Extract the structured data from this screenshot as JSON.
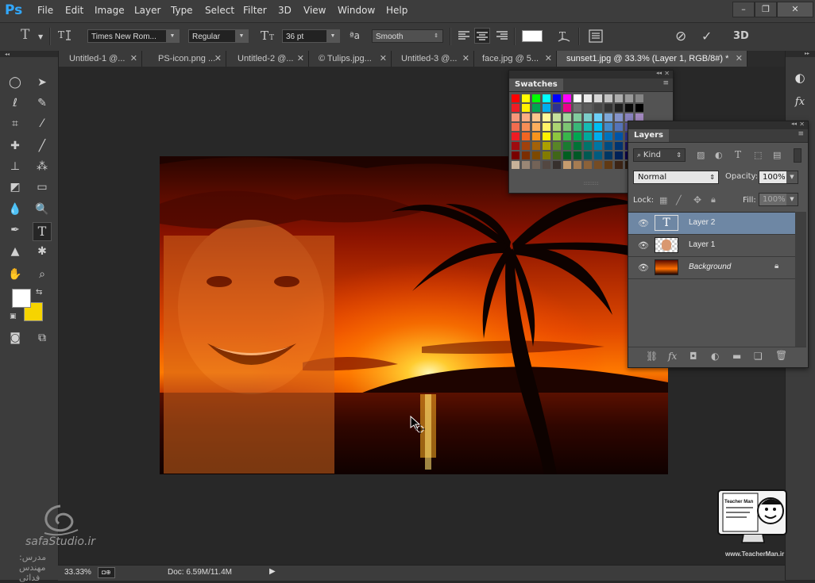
{
  "app": {
    "logo": "Ps"
  },
  "menu": [
    "File",
    "Edit",
    "Image",
    "Layer",
    "Type",
    "Select",
    "Filter",
    "3D",
    "View",
    "Window",
    "Help"
  ],
  "window_controls": [
    "–",
    "❐",
    "✕"
  ],
  "options": {
    "tool_glyph": "T",
    "font_family": "Times New Rom...",
    "font_style": "Regular",
    "font_size": "36 pt",
    "aa_label": "ªa",
    "antialias": "Smooth",
    "cancel_glyph": "⊘",
    "commit_glyph": "✓",
    "three_d": "3D",
    "text_color": "#ffffff"
  },
  "tabs": [
    {
      "label": "Untitled-1 @...",
      "active": false
    },
    {
      "label": "PS-icon.png ...",
      "active": false
    },
    {
      "label": "Untitled-2 @...",
      "active": false
    },
    {
      "label": "© Tulips.jpg...",
      "active": false
    },
    {
      "label": "Untitled-3 @...",
      "active": false
    },
    {
      "label": "face.jpg @ 5...",
      "active": false
    },
    {
      "label": "sunset1.jpg @ 33.3% (Layer 1, RGB/8#) *",
      "active": true
    }
  ],
  "tab_close": "✕",
  "tools": {
    "foreground_color": "#ffffff",
    "background_color": "#f6d400"
  },
  "swatches": {
    "title": "Swatches",
    "rows": [
      [
        "#ff0000",
        "#ffff00",
        "#00ff00",
        "#00ffff",
        "#0000ff",
        "#ff00ff",
        "#ffffff",
        "#ebebeb",
        "#d6d6d6",
        "#c2c2c2",
        "#adadad",
        "#999999",
        "#858585"
      ],
      [
        "#ee1c24",
        "#fff200",
        "#00a651",
        "#00aeef",
        "#2e3192",
        "#ec008c",
        "#707070",
        "#5c5c5c",
        "#474747",
        "#333333",
        "#1f1f1f",
        "#0a0a0a",
        "#000000"
      ],
      [
        "#f7977a",
        "#fbad82",
        "#fdc68c",
        "#fff799",
        "#c6df9c",
        "#a4d49d",
        "#81ca9d",
        "#7bcdc9",
        "#6ccff7",
        "#7ea7d8",
        "#8493ca",
        "#8882be",
        "#a187be"
      ],
      [
        "#f26c4f",
        "#f68e56",
        "#fbaf5d",
        "#fff467",
        "#acd372",
        "#7dc473",
        "#39b778",
        "#16bcb4",
        "#00bff3",
        "#448ccb",
        "#5574b9",
        "#605ca8",
        "#855fa8"
      ],
      [
        "#ed1c24",
        "#f26522",
        "#f7941d",
        "#fff200",
        "#8dc63f",
        "#39b54a",
        "#00a651",
        "#00a99d",
        "#00aeef",
        "#0072bc",
        "#0054a6",
        "#2e3192",
        "#662d91"
      ],
      [
        "#9e0b0f",
        "#a0410d",
        "#a36209",
        "#aba000",
        "#598527",
        "#1a7b30",
        "#007236",
        "#00746b",
        "#0076a3",
        "#004b80",
        "#003471",
        "#1b1464",
        "#440e62"
      ],
      [
        "#790000",
        "#7b2e00",
        "#7d4900",
        "#827b00",
        "#406618",
        "#005e20",
        "#005826",
        "#005952",
        "#005b7f",
        "#003663",
        "#002157",
        "#0d004c",
        "#32004b"
      ],
      [
        "#c7b299",
        "#998675",
        "#736357",
        "#534741",
        "#37302d",
        "#c69c6e",
        "#a67c52",
        "#8c6239",
        "#754c24",
        "#603913",
        "#3c2415",
        "#2b1a0d",
        "#1a0f08"
      ]
    ]
  },
  "layers": {
    "title": "Layers",
    "kind_label": "Kind",
    "blend_mode": "Normal",
    "opacity_label": "Opacity:",
    "opacity_value": "100%",
    "lock_label": "Lock:",
    "fill_label": "Fill:",
    "fill_value": "100%",
    "items": [
      {
        "name": "Layer 2",
        "type": "text",
        "selected": true,
        "italic": false
      },
      {
        "name": "Layer 1",
        "type": "image",
        "selected": false,
        "italic": false
      },
      {
        "name": "Background",
        "type": "image",
        "selected": false,
        "italic": true,
        "locked": true
      }
    ],
    "footer_icons": [
      "link-icon",
      "fx-icon",
      "mask-icon",
      "adjustment-icon",
      "folder-icon",
      "new-layer-icon",
      "trash-icon"
    ]
  },
  "status": {
    "zoom": "33.33%",
    "doc": "Doc: 6.59M/11.4M"
  },
  "watermarks": {
    "left_brand": "safaStudio.ir",
    "left_sub": "مدرس: مهندس فدائی",
    "right_brand": "www.TeacherMan.ir",
    "right_logo_text": "Teacher Man"
  }
}
